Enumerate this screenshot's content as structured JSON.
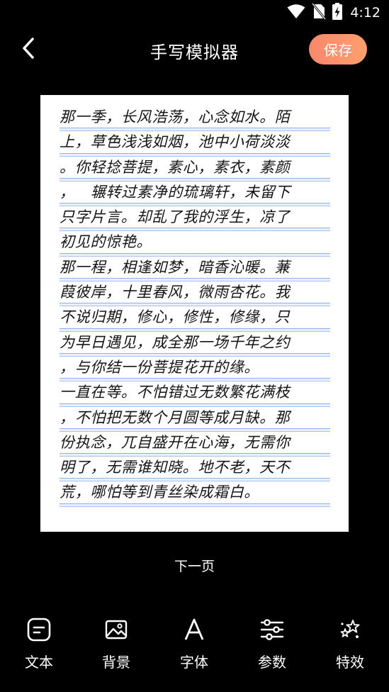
{
  "status_bar": {
    "time": "4:12",
    "icons": [
      "wifi-icon",
      "no-sim-icon",
      "battery-charging-icon"
    ]
  },
  "header": {
    "back_icon": "chevron-left-icon",
    "title": "手写模拟器",
    "save_label": "保存",
    "save_gradient": [
      "#f9876b",
      "#fda06d"
    ]
  },
  "paper": {
    "lines": [
      "那一季，长风浩荡，心念如水。陌",
      "上，草色浅浅如烟，池中小荷淡淡",
      "。你轻捻菩提，素心，素衣，素颜",
      "，   辗转过素净的琉璃轩，未留下",
      "只字片言。却乱了我的浮生，凉了",
      "初见的惊艳。",
      "那一程，相逢如梦，暗香沁暖。蒹",
      "葭彼岸，十里春风，微雨杏花。我",
      "不说归期，修心，修性，修缘，只",
      "为早日遇见，成全那一场千年之约",
      "，与你结一份菩提花开的缘。",
      "一直在等。不怕错过无数繁花满枝",
      "，不怕把无数个月圆等成月缺。那",
      "份执念，兀自盛开在心海，无需你",
      "明了，无需谁知晓。地不老，天不",
      "荒，哪怕等到青丝染成霜白。"
    ],
    "ruling_color": "#8fb2e6"
  },
  "next_page_label": "下一页",
  "toolbar": {
    "items": [
      {
        "name": "text",
        "icon": "text-box-icon",
        "label": "文本"
      },
      {
        "name": "background",
        "icon": "image-icon",
        "label": "背景"
      },
      {
        "name": "font",
        "icon": "font-a-icon",
        "label": "字体"
      },
      {
        "name": "params",
        "icon": "sliders-icon",
        "label": "参数"
      },
      {
        "name": "effects",
        "icon": "sparkle-stars-icon",
        "label": "特效"
      }
    ]
  }
}
